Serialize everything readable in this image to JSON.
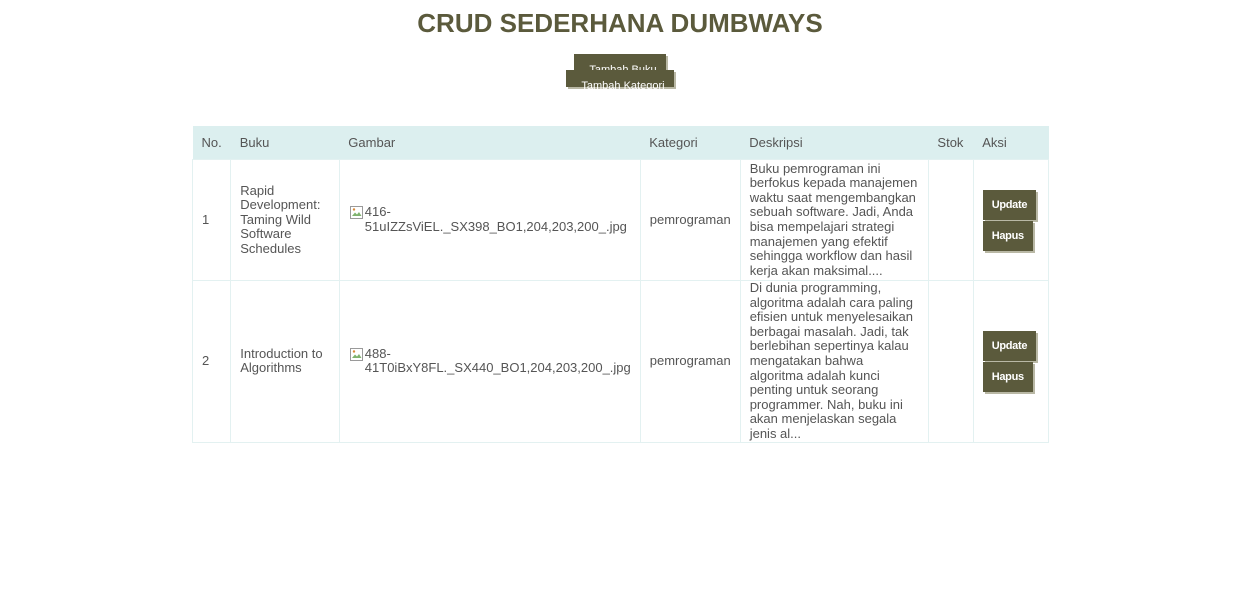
{
  "page": {
    "title": "CRUD SEDERHANA DUMBWAYS"
  },
  "actions": {
    "add_book_label": "Tambah Buku",
    "add_category_label": "Tambah Kategori"
  },
  "table": {
    "headers": [
      "No.",
      "Buku",
      "Gambar",
      "Kategori",
      "Deskripsi",
      "Stok",
      "Aksi"
    ],
    "rows": [
      {
        "no": "1",
        "title": "Rapid Development: Taming Wild Software Schedules",
        "image_alt": "416-51uIZZsViEL._SX398_BO1,204,203,200_.jpg",
        "category": "pemrograman",
        "description": "Buku pemrograman ini berfokus kepada manajemen waktu saat mengembangkan sebuah software. Jadi, Anda bisa mempelajari strategi manajemen yang efektif sehingga workflow dan hasil kerja akan maksimal....",
        "stock": "",
        "update_label": "Update",
        "delete_label": "Hapus"
      },
      {
        "no": "2",
        "title": "Introduction to Algorithms",
        "image_alt": "488-41T0iBxY8FL._SX440_BO1,204,203,200_.jpg",
        "category": "pemrograman",
        "description": "Di dunia programming, algoritma adalah cara paling efisien untuk menyelesaikan berbagai masalah. Jadi, tak berlebihan sepertinya kalau mengatakan bahwa algoritma adalah kunci penting untuk seorang programmer. Nah, buku ini akan menjelaskan segala jenis al...",
        "stock": "",
        "update_label": "Update",
        "delete_label": "Hapus"
      }
    ]
  },
  "colors": {
    "accent": "#5b5a3c",
    "header_bg": "#dcefef",
    "text": "#555555"
  },
  "icons": {
    "broken_image": "broken-image-icon"
  }
}
